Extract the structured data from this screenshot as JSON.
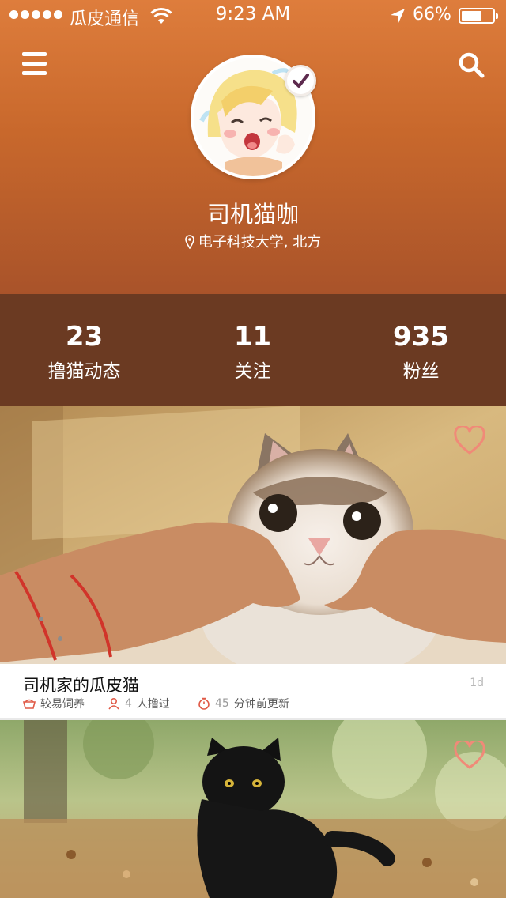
{
  "status_bar": {
    "carrier": "瓜皮通信",
    "time": "9:23 AM",
    "battery_percent": "66%",
    "battery_level": 0.66,
    "signal_dots": 5
  },
  "header": {
    "menu_icon": "hamburger-menu-icon",
    "search_icon": "search-icon",
    "verified_icon": "checkmark-icon",
    "username": "司机猫咖",
    "location": "电子科技大学, 北方"
  },
  "stats": [
    {
      "value": "23",
      "label": "撸猫动态"
    },
    {
      "value": "11",
      "label": "关注"
    },
    {
      "value": "935",
      "label": "粉丝"
    }
  ],
  "feed": [
    {
      "title": "司机家的瓜皮猫",
      "time": "1d",
      "difficulty": "较易饲养",
      "people_count": "4",
      "people_label": "人撸过",
      "minutes": "45",
      "minutes_label": "分钟前更新"
    },
    {
      "liked": false
    }
  ],
  "colors": {
    "header_top": "#de7d3c",
    "header_bottom": "#a9532a",
    "stats_bg": "#6b3a22",
    "heart": "#f08a78",
    "meta_icon": "#e05a47"
  }
}
